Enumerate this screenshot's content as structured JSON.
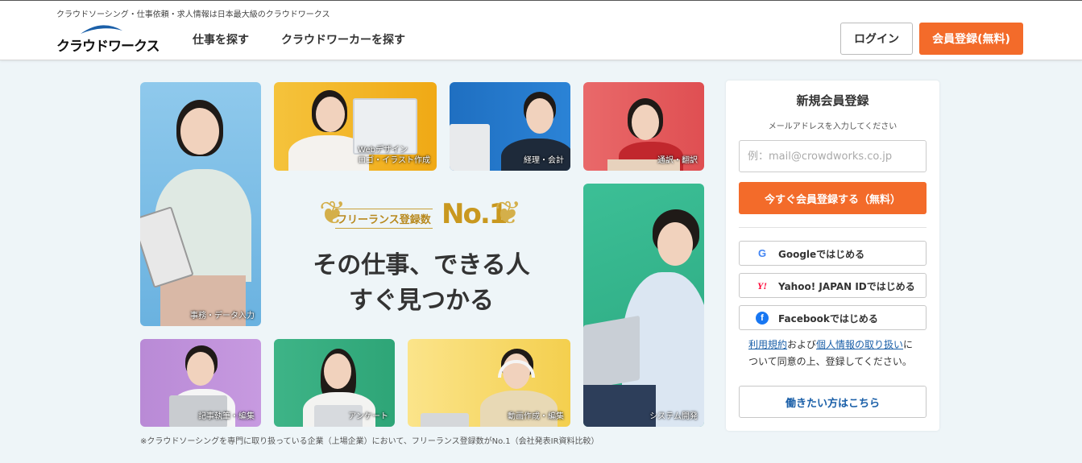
{
  "header": {
    "tagline": "クラウドソーシング・仕事依頼・求人情報は日本最大級のクラウドワークス",
    "logo_text": "クラウドワークス",
    "nav": [
      {
        "label": "仕事を探す"
      },
      {
        "label": "クラウドワーカーを探す"
      }
    ],
    "login_label": "ログイン",
    "register_label": "会員登録(無料)"
  },
  "tiles": [
    {
      "caption": "事務・データ入力"
    },
    {
      "caption_line1": "Webデザイン",
      "caption_line2": "ロゴ・イラスト作成"
    },
    {
      "caption": "経理・会計"
    },
    {
      "caption": "通訳・翻訳"
    },
    {
      "caption": "システム開発"
    },
    {
      "caption": "記事執筆・編集"
    },
    {
      "caption": "アンケート"
    },
    {
      "caption": "動画作成・編集"
    }
  ],
  "hero": {
    "badge_label": "フリーランス登録数",
    "badge_rank": "No.1",
    "headline_line1": "その仕事、できる人",
    "headline_line2": "すぐ見つかる",
    "footnote": "※クラウドソーシングを専門に取り扱っている企業（上場企業）において、フリーランス登録数がNo.1（会社発表IR資料比較）"
  },
  "signup": {
    "title": "新規会員登録",
    "subtitle": "メールアドレスを入力してください",
    "email_placeholder": "例：mail@crowdworks.co.jp",
    "submit_label": "今すぐ会員登録する（無料）",
    "google_label": "Googleではじめる",
    "yahoo_label": "Yahoo! JAPAN IDではじめる",
    "facebook_label": "Facebookではじめる",
    "terms_link": "利用規約",
    "terms_and": "および",
    "privacy_link": "個人情報の取り扱い",
    "terms_rest": "について同意の上、登録してください。",
    "worker_label": "働きたい方はこちら"
  },
  "colors": {
    "accent_orange": "#f36b2a",
    "link_blue": "#1a5fa8",
    "gold": "#c9981f"
  },
  "icons": {
    "google": "google-icon",
    "yahoo": "yahoo-icon",
    "facebook": "facebook-icon"
  }
}
